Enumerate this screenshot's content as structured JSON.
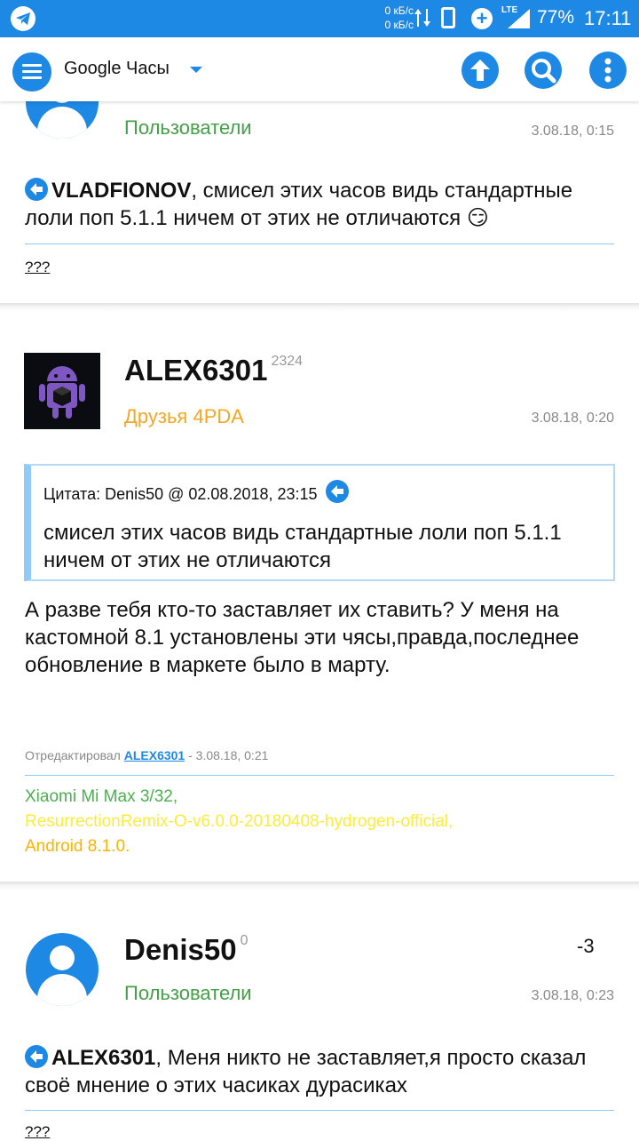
{
  "status_bar": {
    "net_speed_up": "0 кБ/с",
    "net_speed_down": "0 кБ/с",
    "network_type": "LTE",
    "battery": "77%",
    "time": "17:11"
  },
  "app_bar": {
    "title": "Google Часы",
    "accent_color": "#1e88e5"
  },
  "posts": [
    {
      "group": "Пользователи",
      "date": "3.08.18, 0:15",
      "reply_to": "VLADFIONOV",
      "text": ", смисел этих часов видь стандартные лоли поп 5.1.1 ничем от этих не отличаются",
      "emoji": "😏",
      "signature": "???"
    },
    {
      "author": "ALEX6301",
      "reputation": "2324",
      "group": "Друзья 4PDA",
      "date": "3.08.18, 0:20",
      "quote": {
        "header": "Цитата: Denis50 @ 02.08.2018, 23:15",
        "text": "смисел этих часов видь стандартные лоли поп 5.1.1 ничем от этих не отличаются"
      },
      "text": "А разве тебя кто-то заставляет их ставить? У меня на кастомной 8.1 установлены эти чясы,правда,последнее обновление в маркете было в марту.",
      "edited_label": "Отредактировал",
      "edited_by": "ALEX6301",
      "edited_date": " - 3.08.18, 0:21",
      "signature_lines": [
        "Xiaomi Mi Max 3/32,",
        "ResurrectionRemix-O-v6.0.0-20180408-hydrogen-official,",
        "Android 8.1.0."
      ]
    },
    {
      "author": "Denis50",
      "reputation": "0",
      "group": "Пользователи",
      "date": "3.08.18, 0:23",
      "score": "-3",
      "reply_to": "ALEX6301",
      "text": ", Меня никто не заставляет,я просто сказал своё мнение о этих часиках дурасиках",
      "signature": "???"
    }
  ]
}
